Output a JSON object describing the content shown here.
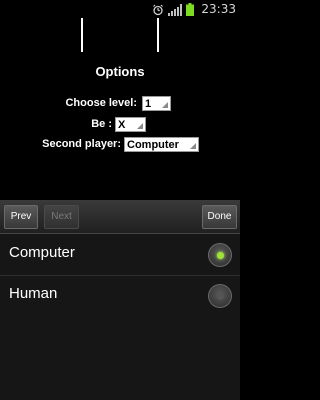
{
  "status_bar": {
    "time": "23:33",
    "icons": [
      "alarm-icon",
      "signal-icon",
      "battery-icon"
    ],
    "battery_color": "#7ddc1f"
  },
  "dialog": {
    "title": "Options",
    "fields": {
      "level": {
        "label": "Choose level:",
        "value": "1"
      },
      "be": {
        "label": "Be :",
        "value": "X"
      },
      "second_player": {
        "label": "Second player:",
        "value": "Computer"
      }
    }
  },
  "picker": {
    "prev_label": "Prev",
    "next_label": "Next",
    "done_label": "Done",
    "options": [
      {
        "label": "Computer",
        "selected": true
      },
      {
        "label": "Human",
        "selected": false
      }
    ],
    "accent_color": "#9fe33a"
  }
}
